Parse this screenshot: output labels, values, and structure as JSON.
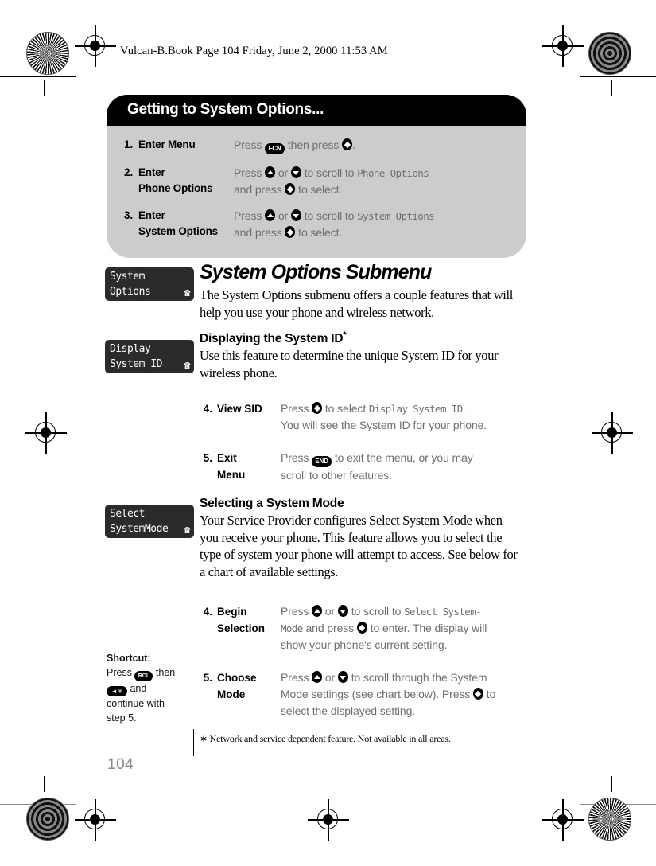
{
  "running_header": "Vulcan-B.Book  Page 104  Friday, June 2, 2000  11:53 AM",
  "callout": {
    "title": "Getting to System Options...",
    "steps": [
      {
        "num": "1.",
        "title": "Enter Menu",
        "parts": [
          {
            "t": "text",
            "v": "Press "
          },
          {
            "t": "key-oval",
            "v": "FCN"
          },
          {
            "t": "text",
            "v": " then press "
          },
          {
            "t": "key-diamond",
            "v": ""
          },
          {
            "t": "text",
            "v": "."
          }
        ]
      },
      {
        "num": "2.",
        "title": "Enter\nPhone Options",
        "parts": [
          {
            "t": "text",
            "v": "Press "
          },
          {
            "t": "key-up",
            "v": ""
          },
          {
            "t": "text",
            "v": " or "
          },
          {
            "t": "key-down",
            "v": ""
          },
          {
            "t": "text",
            "v": " to scroll to "
          },
          {
            "t": "lcd",
            "v": "Phone Options"
          },
          {
            "t": "br",
            "v": ""
          },
          {
            "t": "text",
            "v": "and press "
          },
          {
            "t": "key-diamond",
            "v": ""
          },
          {
            "t": "text",
            "v": " to select."
          }
        ]
      },
      {
        "num": "3.",
        "title": "Enter\nSystem Options",
        "parts": [
          {
            "t": "text",
            "v": "Press "
          },
          {
            "t": "key-up",
            "v": ""
          },
          {
            "t": "text",
            "v": " or "
          },
          {
            "t": "key-down",
            "v": ""
          },
          {
            "t": "text",
            "v": " to scroll to "
          },
          {
            "t": "lcd",
            "v": "System Options"
          },
          {
            "t": "br",
            "v": ""
          },
          {
            "t": "text",
            "v": "and press "
          },
          {
            "t": "key-diamond",
            "v": ""
          },
          {
            "t": "text",
            "v": " to select."
          }
        ]
      }
    ]
  },
  "lcd_displays": [
    {
      "line1": "System",
      "line2": "Options",
      "icon": "phone-icon"
    },
    {
      "line1": "Display",
      "line2": "System ID",
      "icon": "phone-icon"
    },
    {
      "line1": "Select",
      "line2": "SystemMode",
      "icon": "phone-icon"
    }
  ],
  "section": {
    "title": "System Options Submenu",
    "intro": "The System Options submenu offers a couple features that will help you use your phone and wireless network."
  },
  "subsection_sid": {
    "title": "Displaying the System ID",
    "title_marker": "*",
    "body": "Use this feature to determine the unique System ID for your wireless phone.",
    "steps": [
      {
        "num": "4.",
        "title": "View SID",
        "parts": [
          {
            "t": "text",
            "v": "Press "
          },
          {
            "t": "key-diamond",
            "v": ""
          },
          {
            "t": "text",
            "v": " to select "
          },
          {
            "t": "lcd",
            "v": "Display System ID"
          },
          {
            "t": "text",
            "v": "."
          },
          {
            "t": "br",
            "v": ""
          },
          {
            "t": "text",
            "v": "You will see the System ID for your phone."
          }
        ]
      },
      {
        "num": "5.",
        "title": "Exit\nMenu",
        "parts": [
          {
            "t": "text",
            "v": "Press "
          },
          {
            "t": "key-oval",
            "v": "END"
          },
          {
            "t": "text",
            "v": " to exit the menu, or you may"
          },
          {
            "t": "br",
            "v": ""
          },
          {
            "t": "text",
            "v": "scroll to other features."
          }
        ]
      }
    ]
  },
  "subsection_mode": {
    "title": "Selecting a System Mode",
    "body": "Your Service Provider configures Select System Mode when you receive your phone. This feature allows you to select the type of system your phone will attempt to access. See below for a chart of available settings.",
    "steps": [
      {
        "num": "4.",
        "title": "Begin\nSelection",
        "parts": [
          {
            "t": "text",
            "v": "Press "
          },
          {
            "t": "key-up",
            "v": ""
          },
          {
            "t": "text",
            "v": " or "
          },
          {
            "t": "key-down",
            "v": ""
          },
          {
            "t": "text",
            "v": " to scroll to "
          },
          {
            "t": "lcd",
            "v": "Select System-"
          },
          {
            "t": "br",
            "v": ""
          },
          {
            "t": "lcd",
            "v": "Mode"
          },
          {
            "t": "text",
            "v": " and press "
          },
          {
            "t": "key-diamond",
            "v": ""
          },
          {
            "t": "text",
            "v": " to enter. The display will"
          },
          {
            "t": "br",
            "v": ""
          },
          {
            "t": "text",
            "v": "show your phone's current setting."
          }
        ]
      },
      {
        "num": "5.",
        "title": "Choose\nMode",
        "parts": [
          {
            "t": "text",
            "v": "Press "
          },
          {
            "t": "key-up",
            "v": ""
          },
          {
            "t": "text",
            "v": " or "
          },
          {
            "t": "key-down",
            "v": ""
          },
          {
            "t": "text",
            "v": " to scroll through the System"
          },
          {
            "t": "br",
            "v": ""
          },
          {
            "t": "text",
            "v": "Mode settings (see chart below). Press "
          },
          {
            "t": "key-diamond",
            "v": ""
          },
          {
            "t": "text",
            "v": " to"
          },
          {
            "t": "br",
            "v": ""
          },
          {
            "t": "text",
            "v": "select the displayed setting."
          }
        ]
      }
    ]
  },
  "shortcut": {
    "heading": "Shortcut:",
    "parts": [
      {
        "t": "text",
        "v": "Press "
      },
      {
        "t": "key-rcl",
        "v": "RCL"
      },
      {
        "t": "text",
        "v": " then"
      },
      {
        "t": "br",
        "v": ""
      },
      {
        "t": "key-star",
        "v": "◄✳"
      },
      {
        "t": "text",
        "v": " and"
      },
      {
        "t": "br",
        "v": ""
      },
      {
        "t": "text",
        "v": "continue with"
      },
      {
        "t": "br",
        "v": ""
      },
      {
        "t": "text",
        "v": "step 5."
      }
    ]
  },
  "footnote": "∗ Network and service dependent feature. Not available in all areas.",
  "page_number": "104",
  "colors": {
    "callout_header_bg": "#000000",
    "callout_body_bg": "#cccccc",
    "body_gray": "#6f6f6f",
    "lcd_bg": "#2b2b2b",
    "folio_gray": "#8a8a8a"
  }
}
